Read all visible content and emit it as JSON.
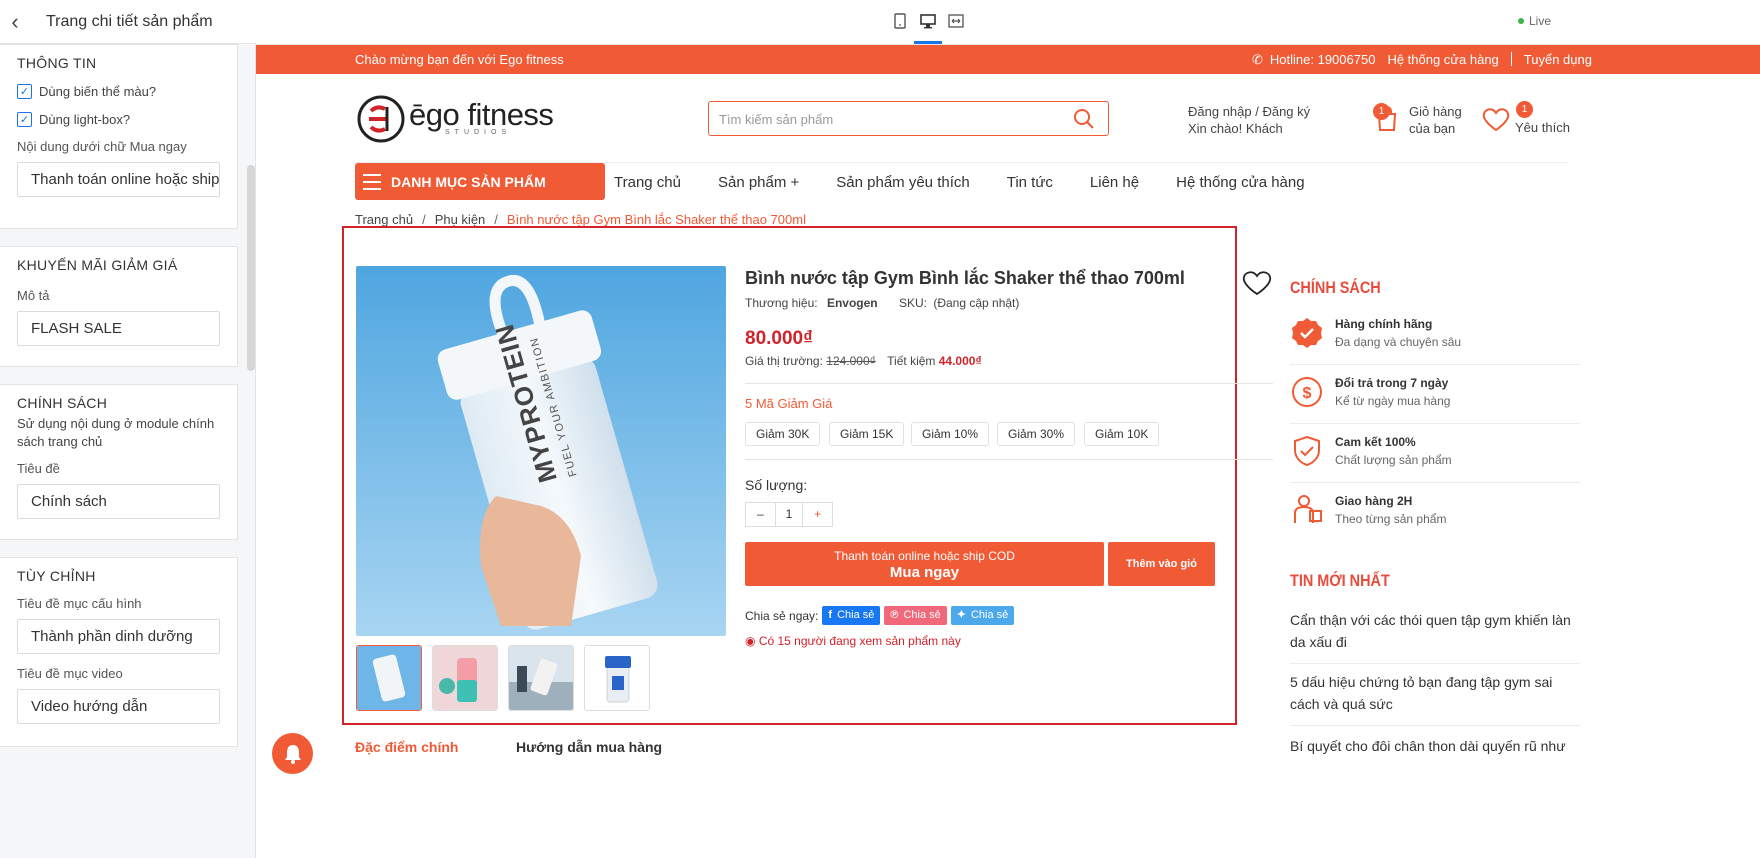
{
  "editor": {
    "title": "Trang chi tiết sản phẩm",
    "sections": {
      "info": {
        "heading": "THÔNG TIN",
        "option_color": "Dùng biến thể màu?",
        "option_lightbox": "Dùng light-box?",
        "buy_note_label": "Nội dung dưới chữ Mua ngay",
        "buy_note_value": "Thanh toán online hoặc ship COD"
      },
      "promo": {
        "heading": "KHUYẾN MÃI GIẢM GIÁ",
        "desc_label": "Mô tả",
        "desc_value": "FLASH SALE"
      },
      "policy": {
        "heading": "CHÍNH SÁCH",
        "description": "Sử dụng nội dung ở module chính sách trang chủ",
        "title_label": "Tiêu đề",
        "title_value": "Chính sách"
      },
      "custom": {
        "heading": "TÙY CHỈNH",
        "config_label": "Tiêu đề mục cấu hình",
        "config_value": "Thành phần dinh dưỡng",
        "video_label": "Tiêu đề mục video",
        "video_value": "Video hướng dẫn"
      }
    }
  },
  "toolbar": {
    "live_label": "Live"
  },
  "site": {
    "welcome": "Chào mừng bạn đến với Ego fitness",
    "hotline": "Hotline: 19006750",
    "stores": "Hệ thống cửa hàng",
    "recruit": "Tuyển dụng",
    "logo_text": "ēgo fitness",
    "logo_sub": "STUDIOS",
    "search_placeholder": "Tìm kiếm sản phẩm",
    "account_line1": "Đăng nhập /  Đăng ký",
    "account_line2": "Xin chào! Khách",
    "cart_line1": "Giỏ hàng",
    "cart_line2": "của bạn",
    "cart_count": "1",
    "fav_label": "Yêu thích",
    "fav_count": "1",
    "category_button": "DANH MỤC SẢN PHẨM",
    "nav": [
      "Trang chủ",
      "Sản phẩm +",
      "Sản phẩm yêu thích",
      "Tin tức",
      "Liên hệ",
      "Hệ thống cửa hàng"
    ],
    "breadcrumb": [
      "Trang chủ",
      "Phụ kiện",
      "Bình nước tập Gym Bình lắc Shaker thể thao 700ml"
    ],
    "breadcrumb_sep": "/"
  },
  "product": {
    "title": "Bình nước tập Gym Bình lắc Shaker thể thao 700ml",
    "brand_label": "Thương hiệu:",
    "brand": "Envogen",
    "sku_label": "SKU:",
    "sku": "(Đang cập nhật)",
    "price": "80.000₫",
    "market_label": "Giá thị trường:",
    "market_price": "124.000₫",
    "save_label": "Tiết kiệm",
    "save_value": "44.000₫",
    "coupon_title": "5 Mã Giảm Giá",
    "coupons": [
      "Giảm 30K",
      "Giảm 15K",
      "Giảm 10%",
      "Giảm 30%",
      "Giảm 10K"
    ],
    "qty_label": "Số lượng:",
    "qty_minus": "–",
    "qty_value": "1",
    "qty_plus": "+",
    "buy_sub": "Thanh toán online hoặc ship COD",
    "buy_main": "Mua ngay",
    "add_cart": "Thêm vào giỏ",
    "share_label": "Chia sẻ ngay:",
    "share_buttons": [
      "Chia sẻ",
      "Chia sẻ",
      "Chia sẻ"
    ],
    "viewing": "Có 15 người đang xem sản phẩm này",
    "image_text_1": "MYPROTEIN",
    "image_text_2": "FUEL YOUR AMBITION"
  },
  "sidebar": {
    "policy_title": "CHÍNH SÁCH",
    "policies": [
      {
        "title": "Hàng chính hãng",
        "sub": "Đa dạng và chuyên sâu"
      },
      {
        "title": "Đổi trả trong 7 ngày",
        "sub": "Kể từ ngày mua hàng"
      },
      {
        "title": "Cam kết 100%",
        "sub": "Chất lượng sản phẩm"
      },
      {
        "title": "Giao hàng 2H",
        "sub": "Theo từng sản phẩm"
      }
    ],
    "news_title": "TIN MỚI NHẤT",
    "news": [
      "Cẩn thận với các thói quen tập gym khiến làn da xấu đi",
      "5 dấu hiệu chứng tỏ bạn đang tập gym sai cách và quá sức",
      "Bí quyết cho đôi chân thon dài quyến rũ như Wonder Woman"
    ]
  },
  "tabs": [
    "Đặc điểm chính",
    "Hướng dẫn mua hàng"
  ],
  "colors": {
    "brand": "#f05a35",
    "price": "#d2222a",
    "editor_accent": "#1a73e8",
    "facebook": "#1877f2",
    "pinterest": "#f0687a",
    "twitter": "#4aa8eb"
  }
}
